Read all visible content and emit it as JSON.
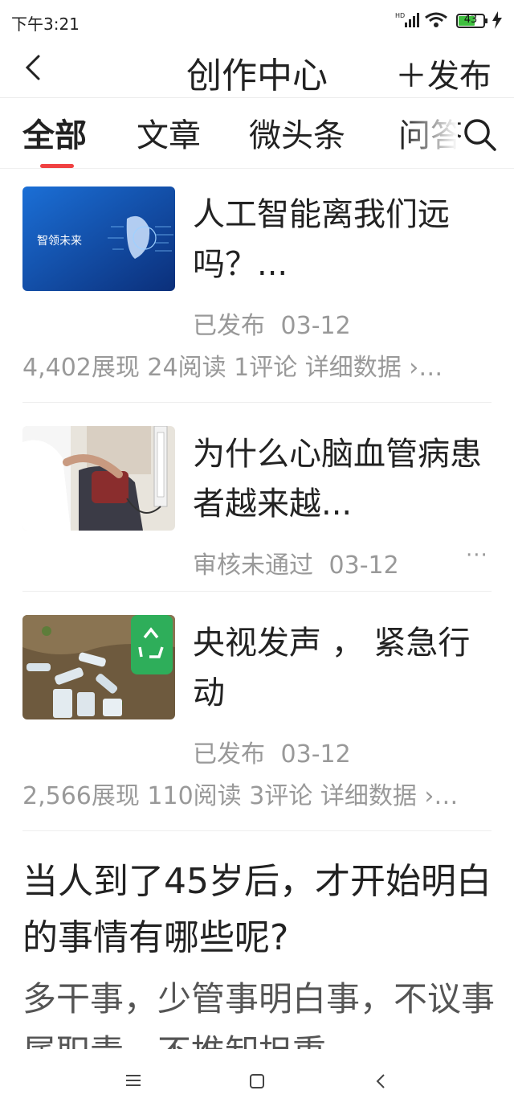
{
  "status_bar": {
    "time": "下午3:21",
    "battery": "43"
  },
  "header": {
    "title": "创作中心",
    "publish_label": "＋发布"
  },
  "tabs": [
    {
      "label": "全部",
      "active": true
    },
    {
      "label": "文章",
      "active": false
    },
    {
      "label": "微头条",
      "active": false
    },
    {
      "label": "问答",
      "active": false
    }
  ],
  "articles": [
    {
      "title": "人工智能离我们远吗？...",
      "status": "已发布",
      "date": "03-12",
      "stats": "4,402展现  24阅读  1评论  详细数据 ›…",
      "thumb_text": "智领未来"
    },
    {
      "title": "为什么心脑血管病患者越来越...",
      "status": "审核未通过",
      "date": "03-12",
      "more": "···"
    },
    {
      "title": "央视发声 ， 紧急行动",
      "status": "已发布",
      "date": "03-12",
      "stats": "2,566展现  110阅读  3评论  详细数据 ›…"
    }
  ],
  "post": {
    "title": "当人到了45岁后，才开始明白的事情有哪些呢?",
    "body": "多干事，少管事明白事，不议事属职责，不推卸担重"
  },
  "colors": {
    "accent": "#f04142",
    "text": "#222222",
    "muted": "#999999"
  }
}
